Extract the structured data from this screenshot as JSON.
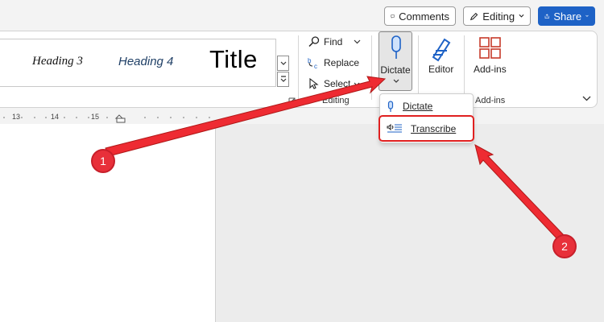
{
  "topbar": {
    "comments_label": "Comments",
    "editing_label": "Editing",
    "share_label": "Share"
  },
  "styles": {
    "heading3": "Heading 3",
    "heading4": "Heading 4",
    "title": "Title"
  },
  "editing": {
    "find_label": "Find",
    "replace_label": "Replace",
    "select_label": "Select",
    "group_label": "Editing"
  },
  "voice": {
    "dictate_label": "Dictate"
  },
  "editor": {
    "label": "Editor"
  },
  "addins": {
    "button_label": "Add-ins",
    "group_label": "Add-ins"
  },
  "ruler": {
    "marks": [
      "13",
      "14",
      "15"
    ]
  },
  "dictate_menu": {
    "items": [
      {
        "label": "Dictate",
        "icon": "microphone-icon"
      },
      {
        "label": "Transcribe",
        "icon": "transcribe-icon"
      }
    ]
  },
  "annotations": {
    "marker1": "1",
    "marker2": "2"
  },
  "colors": {
    "accent": "#1e62c6",
    "annotation_red": "#e8303a"
  }
}
